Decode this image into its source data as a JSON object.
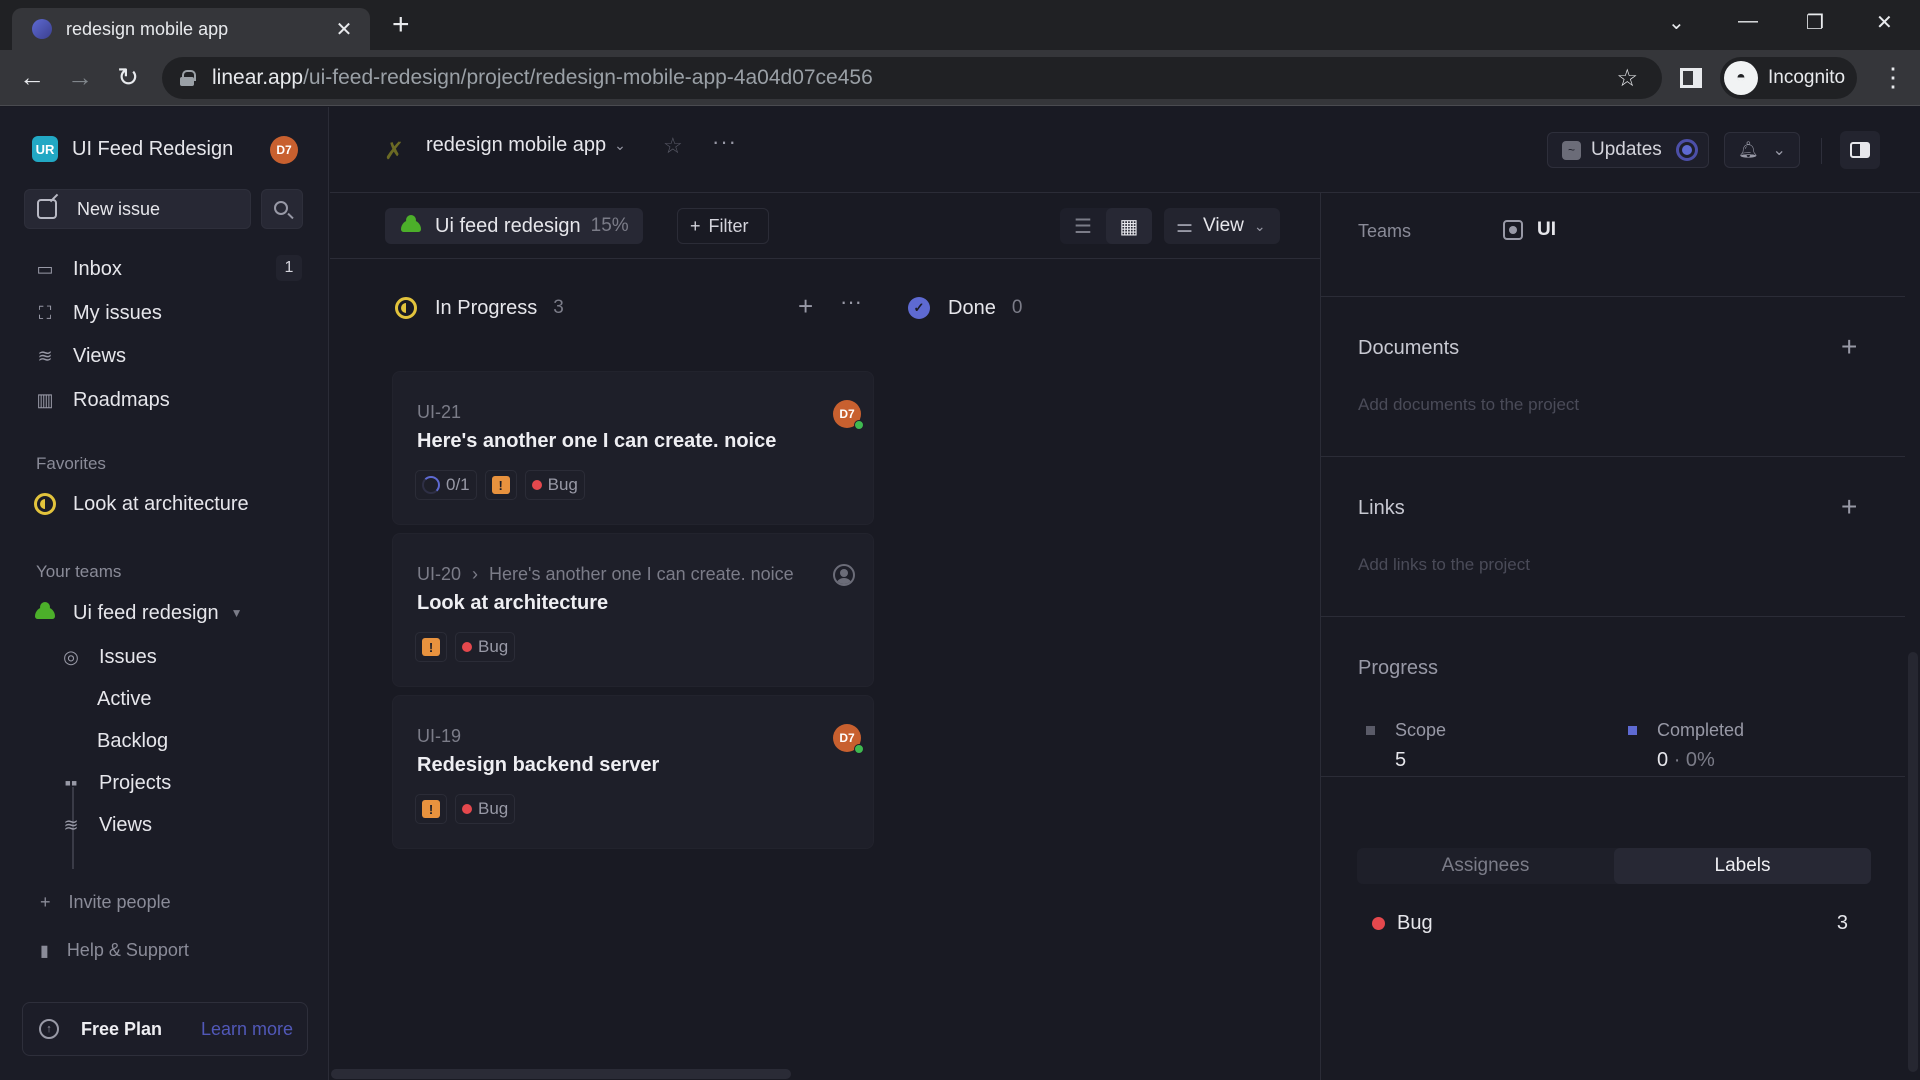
{
  "browser": {
    "tab_title": "redesign mobile app",
    "url_host": "linear.app",
    "url_path": "/ui-feed-redesign/project/redesign-mobile-app-4a04d07ce456",
    "profile_label": "Incognito"
  },
  "sidebar": {
    "workspace_initials": "UR",
    "workspace_name": "UI Feed Redesign",
    "user_avatar": "D7",
    "new_issue_label": "New issue",
    "nav": [
      {
        "label": "Inbox",
        "icon": "inbox-icon",
        "badge": "1"
      },
      {
        "label": "My issues",
        "icon": "my-issues-icon"
      },
      {
        "label": "Views",
        "icon": "views-icon"
      },
      {
        "label": "Roadmaps",
        "icon": "roadmap-icon"
      }
    ],
    "favorites_heading": "Favorites",
    "favorites": [
      {
        "label": "Look at architecture",
        "icon": "in-progress-status-icon"
      }
    ],
    "teams_heading": "Your teams",
    "team": {
      "name": "Ui feed redesign",
      "items": [
        {
          "label": "Issues"
        },
        {
          "label": "Active"
        },
        {
          "label": "Backlog"
        },
        {
          "label": "Projects"
        },
        {
          "label": "Views"
        }
      ]
    },
    "invite_label": "Invite people",
    "help_label": "Help & Support",
    "plan_label": "Free Plan",
    "learn_more_label": "Learn more"
  },
  "header": {
    "project_title": "redesign mobile app",
    "updates_label": "Updates"
  },
  "filterbar": {
    "project_chip_label": "Ui feed redesign",
    "project_chip_progress": "15%",
    "filter_label": "Filter",
    "view_label": "View"
  },
  "board": {
    "columns": [
      {
        "title": "In Progress",
        "count": "3",
        "cards": [
          {
            "id": "UI-21",
            "parent": "",
            "title": "Here's another one I can create. noice",
            "assignee": "D7",
            "subissues": "0/1",
            "label": "Bug"
          },
          {
            "id": "UI-20",
            "parent": "Here's another one I can create. noice",
            "title": "Look at architecture",
            "assignee": "",
            "label": "Bug"
          },
          {
            "id": "UI-19",
            "parent": "",
            "title": "Redesign backend server",
            "assignee": "D7",
            "label": "Bug"
          }
        ]
      },
      {
        "title": "Done",
        "count": "0",
        "cards": []
      }
    ]
  },
  "right_panel": {
    "teams_label": "Teams",
    "teams_value": "UI",
    "documents_heading": "Documents",
    "documents_hint": "Add documents to the project",
    "links_heading": "Links",
    "links_hint": "Add links to the project",
    "progress_heading": "Progress",
    "scope_label": "Scope",
    "scope_value": "5",
    "completed_label": "Completed",
    "completed_value": "0",
    "completed_pct": "· 0%",
    "tabs": [
      {
        "label": "Assignees",
        "active": false
      },
      {
        "label": "Labels",
        "active": true
      }
    ],
    "labels": [
      {
        "name": "Bug",
        "count": "3",
        "color": "#e5484d"
      }
    ]
  },
  "colors": {
    "accent": "#5e6ad2",
    "in_progress": "#e2c33c",
    "bug": "#e5484d",
    "priority": "#e8923e",
    "team_green": "#4caf2a"
  }
}
